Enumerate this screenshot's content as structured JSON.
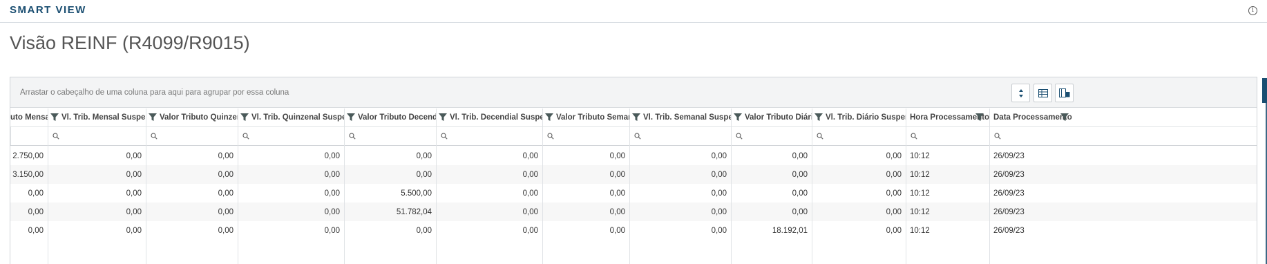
{
  "app": {
    "title": "SMART VIEW",
    "info_icon": "info-icon"
  },
  "page": {
    "title": "Visão REINF (R4099/R9015)"
  },
  "grid": {
    "group_hint": "Arrastar o cabeçalho de uma coluna para aqui para agrupar por essa coluna",
    "toolbar": [
      {
        "name": "expand-rows-button",
        "icon": "sort-arrows-icon"
      },
      {
        "name": "export-excel-button",
        "icon": "spreadsheet-icon"
      },
      {
        "name": "column-chooser-button",
        "icon": "column-chooser-icon"
      }
    ],
    "columns": [
      "uto Mensal",
      "Vl. Trib. Mensal Suspenso",
      "Valor Tributo Quinzenal",
      "Vl. Trib. Quinzenal Suspenso",
      "Valor Tributo Decendial",
      "Vl. Trib. Decendial Suspenso",
      "Valor Tributo Semanal",
      "Vl. Trib. Semanal Suspenso",
      "Valor Tributo Diário",
      "Vl. Trib. Diário Suspenso",
      "Hora Processamento",
      "Data Processamento"
    ],
    "rows": [
      [
        "2.750,00",
        "0,00",
        "0,00",
        "0,00",
        "0,00",
        "0,00",
        "0,00",
        "0,00",
        "0,00",
        "0,00",
        "10:12",
        "26/09/23"
      ],
      [
        "3.150,00",
        "0,00",
        "0,00",
        "0,00",
        "0,00",
        "0,00",
        "0,00",
        "0,00",
        "0,00",
        "0,00",
        "10:12",
        "26/09/23"
      ],
      [
        "0,00",
        "0,00",
        "0,00",
        "0,00",
        "5.500,00",
        "0,00",
        "0,00",
        "0,00",
        "0,00",
        "0,00",
        "10:12",
        "26/09/23"
      ],
      [
        "0,00",
        "0,00",
        "0,00",
        "0,00",
        "51.782,04",
        "0,00",
        "0,00",
        "0,00",
        "0,00",
        "0,00",
        "10:12",
        "26/09/23"
      ],
      [
        "0,00",
        "0,00",
        "0,00",
        "0,00",
        "0,00",
        "0,00",
        "0,00",
        "0,00",
        "18.192,01",
        "0,00",
        "10:12",
        "26/09/23"
      ]
    ]
  },
  "colors": {
    "brand": "#1a4e71",
    "filter_icon": "#4a5a5a"
  }
}
